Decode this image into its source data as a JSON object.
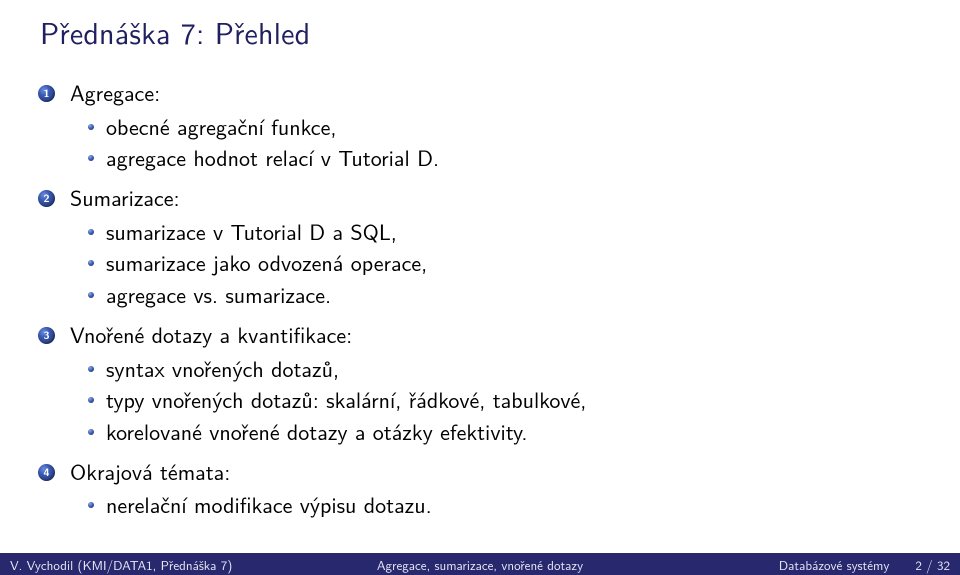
{
  "title": "Přednáška 7: Přehled",
  "items": [
    {
      "n": "1",
      "label": "Agregace:",
      "sub": [
        "obecné agregační funkce,",
        "agregace hodnot relací v Tutorial D."
      ]
    },
    {
      "n": "2",
      "label": "Sumarizace:",
      "sub": [
        "sumarizace v Tutorial D a SQL,",
        "sumarizace jako odvozená operace,",
        "agregace vs. sumarizace."
      ]
    },
    {
      "n": "3",
      "label": "Vnořené dotazy a kvantifikace:",
      "sub": [
        "syntax vnořených dotazů,",
        "typy vnořených dotazů: skalární, řádkové, tabulkové,",
        "korelované vnořené dotazy a otázky efektivity."
      ]
    },
    {
      "n": "4",
      "label": "Okrajová témata:",
      "sub": [
        "nerelační modifikace výpisu dotazu."
      ]
    }
  ],
  "footer": {
    "left": "V. Vychodil (KMI/DATA1, Přednáška 7)",
    "center": "Agregace, sumarizace, vnořené dotazy",
    "right_label": "Databázové systémy",
    "page_current": "2",
    "page_sep": " / ",
    "page_total": "32"
  }
}
